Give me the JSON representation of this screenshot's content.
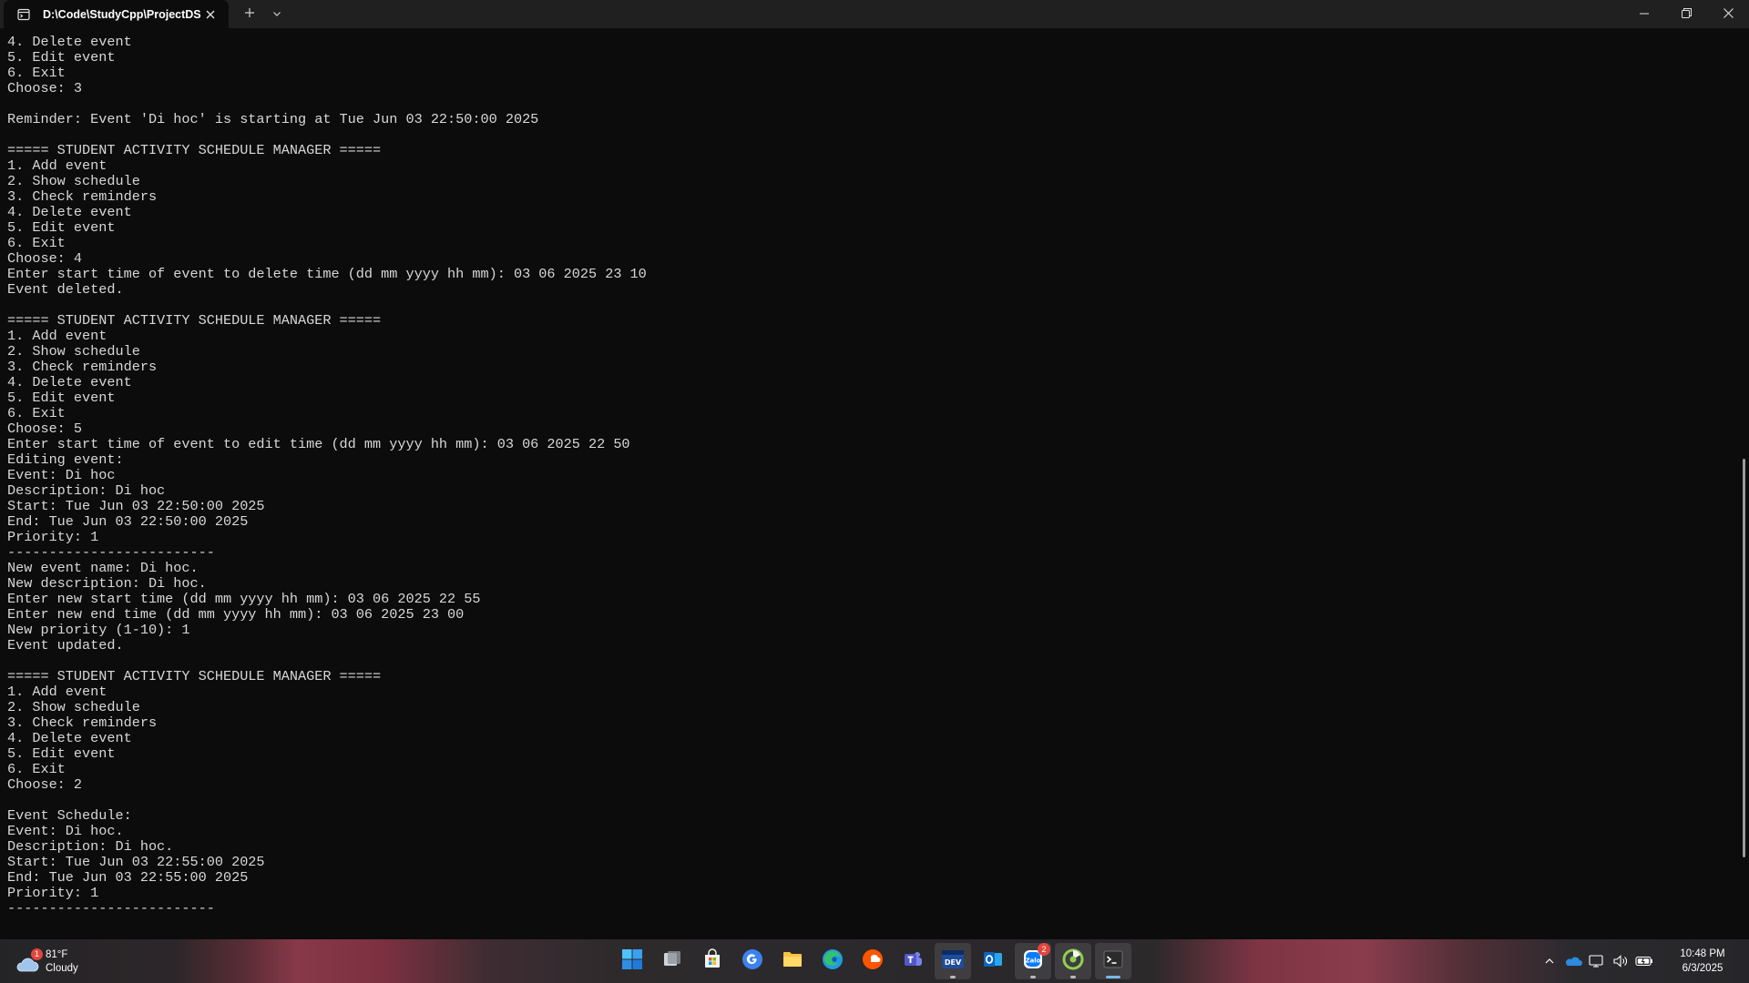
{
  "window": {
    "tab_title": "D:\\Code\\StudyCpp\\ProjectDS",
    "icons": {
      "tab": "terminal-tab-icon",
      "close": "close-icon",
      "new_tab": "plus-icon",
      "dropdown": "chevron-down-icon"
    }
  },
  "terminal": {
    "lines": [
      "4. Delete event",
      "5. Edit event",
      "6. Exit",
      "Choose: 3",
      "",
      "Reminder: Event 'Di hoc' is starting at Tue Jun 03 22:50:00 2025",
      "",
      "===== STUDENT ACTIVITY SCHEDULE MANAGER =====",
      "1. Add event",
      "2. Show schedule",
      "3. Check reminders",
      "4. Delete event",
      "5. Edit event",
      "6. Exit",
      "Choose: 4",
      "Enter start time of event to delete time (dd mm yyyy hh mm): 03 06 2025 23 10",
      "Event deleted.",
      "",
      "===== STUDENT ACTIVITY SCHEDULE MANAGER =====",
      "1. Add event",
      "2. Show schedule",
      "3. Check reminders",
      "4. Delete event",
      "5. Edit event",
      "6. Exit",
      "Choose: 5",
      "Enter start time of event to edit time (dd mm yyyy hh mm): 03 06 2025 22 50",
      "Editing event:",
      "Event: Di hoc",
      "Description: Di hoc",
      "Start: Tue Jun 03 22:50:00 2025",
      "End: Tue Jun 03 22:50:00 2025",
      "Priority: 1",
      "-------------------------",
      "New event name: Di hoc.",
      "New description: Di hoc.",
      "Enter new start time (dd mm yyyy hh mm): 03 06 2025 22 55",
      "Enter new end time (dd mm yyyy hh mm): 03 06 2025 23 00",
      "New priority (1-10): 1",
      "Event updated.",
      "",
      "===== STUDENT ACTIVITY SCHEDULE MANAGER =====",
      "1. Add event",
      "2. Show schedule",
      "3. Check reminders",
      "4. Delete event",
      "5. Edit event",
      "6. Exit",
      "Choose: 2",
      "",
      "Event Schedule:",
      "Event: Di hoc.",
      "Description: Di hoc.",
      "Start: Tue Jun 03 22:55:00 2025",
      "End: Tue Jun 03 22:55:00 2025",
      "Priority: 1",
      "-------------------------"
    ]
  },
  "taskbar": {
    "weather": {
      "temp": "81°F",
      "condition": "Cloudy",
      "badge": "1",
      "icon": "cloud-icon"
    },
    "apps": [
      {
        "name": "start-button",
        "icon": "windows-logo-icon"
      },
      {
        "name": "task-view",
        "icon": "task-view-icon"
      },
      {
        "name": "microsoft-store",
        "icon": "store-icon"
      },
      {
        "name": "google",
        "icon": "google-icon"
      },
      {
        "name": "file-explorer",
        "icon": "folder-icon"
      },
      {
        "name": "microsoft-edge",
        "icon": "edge-icon"
      },
      {
        "name": "soundcloud",
        "icon": "soundcloud-icon"
      },
      {
        "name": "microsoft-teams",
        "icon": "teams-icon"
      },
      {
        "name": "dev-cpp",
        "icon": "devcpp-icon"
      },
      {
        "name": "outlook",
        "icon": "outlook-icon"
      },
      {
        "name": "zalo",
        "icon": "zalo-icon",
        "badge": "2"
      },
      {
        "name": "app-green",
        "icon": "green-app-icon"
      },
      {
        "name": "terminal",
        "icon": "terminal-icon"
      }
    ],
    "clock": {
      "time": "10:48 PM",
      "date": "6/3/2025"
    }
  },
  "colors": {
    "terminal_bg": "#0c0c0c",
    "terminal_text": "#d8d8d8",
    "titlebar_bg": "#202020",
    "accent": "#76b9ed"
  }
}
